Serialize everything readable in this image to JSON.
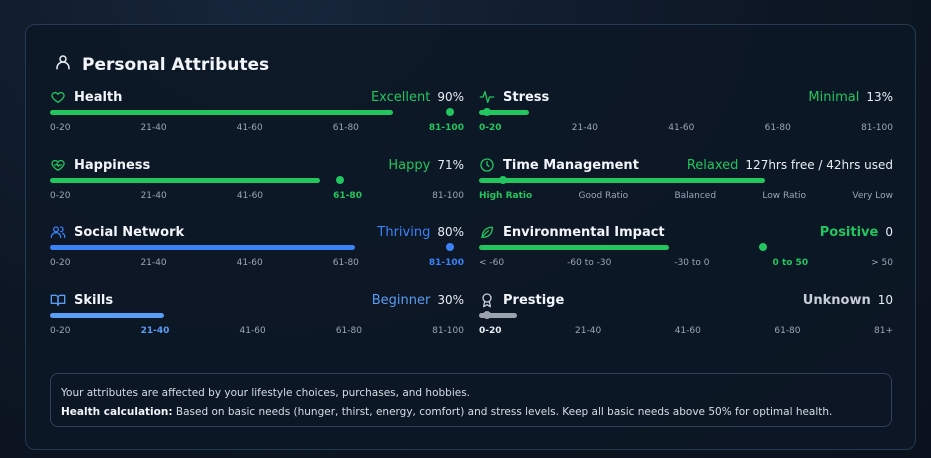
{
  "card": {
    "title": "Personal Attributes",
    "icon": "user-icon"
  },
  "attributes": {
    "health": {
      "name": "Health",
      "icon": "heart-icon",
      "status": "Excellent",
      "value": "90%",
      "level": 0.9,
      "color": "#22c55e",
      "ticks": [
        "0-20",
        "21-40",
        "41-60",
        "61-80",
        "81-100"
      ],
      "active_tick": 4
    },
    "stress": {
      "name": "Stress",
      "icon": "activity-icon",
      "status": "Minimal",
      "value": "13%",
      "level": 0.13,
      "color": "#22c55e",
      "ticks": [
        "0-20",
        "21-40",
        "41-60",
        "61-80",
        "81-100"
      ],
      "active_tick": 0
    },
    "happiness": {
      "name": "Happiness",
      "icon": "heart-pulse-icon",
      "status": "Happy",
      "value": "71%",
      "level": 0.71,
      "color": "#22c55e",
      "ticks": [
        "0-20",
        "21-40",
        "41-60",
        "61-80",
        "81-100"
      ],
      "active_tick": 3
    },
    "time": {
      "name": "Time Management",
      "icon": "clock-icon",
      "status": "Relaxed",
      "value": "127hrs free / 42hrs used",
      "level": 0.75,
      "color": "#22c55e",
      "ticks": [
        "High Ratio",
        "Good Ratio",
        "Balanced",
        "Low Ratio",
        "Very Low"
      ],
      "active_tick": 0
    },
    "social": {
      "name": "Social Network",
      "icon": "users-icon",
      "status": "Thriving",
      "value": "80%",
      "level": 0.8,
      "color": "#3b82f6",
      "ticks": [
        "0-20",
        "21-40",
        "41-60",
        "61-80",
        "81-100"
      ],
      "active_tick": 4
    },
    "environment": {
      "name": "Environmental Impact",
      "icon": "leaf-icon",
      "status": "Positive",
      "value": "0",
      "level": 0.5,
      "color": "#22c55e",
      "ticks": [
        "< -60",
        "-60 to -30",
        "-30 to 0",
        "0 to 50",
        "> 50"
      ],
      "active_tick": 3
    },
    "skills": {
      "name": "Skills",
      "icon": "book-icon",
      "status": "Beginner",
      "value": "30%",
      "level": 0.3,
      "color": "#5b9cf4",
      "ticks": [
        "0-20",
        "21-40",
        "41-60",
        "61-80",
        "81-100"
      ],
      "active_tick": 1
    },
    "prestige": {
      "name": "Prestige",
      "icon": "award-icon",
      "status": "Unknown",
      "value": "10",
      "level": 0.1,
      "color": "#9aa2ad",
      "ticks": [
        "0-20",
        "21-40",
        "41-60",
        "61-80",
        "81+"
      ],
      "active_tick": 0
    }
  },
  "info": {
    "line1": "Your attributes are affected by your lifestyle choices, purchases, and hobbies.",
    "line2_label": "Health calculation:",
    "line2_text": " Based on basic needs (hunger, thirst, energy, comfort) and stress levels. Keep all basic needs above 50% for optimal health."
  }
}
